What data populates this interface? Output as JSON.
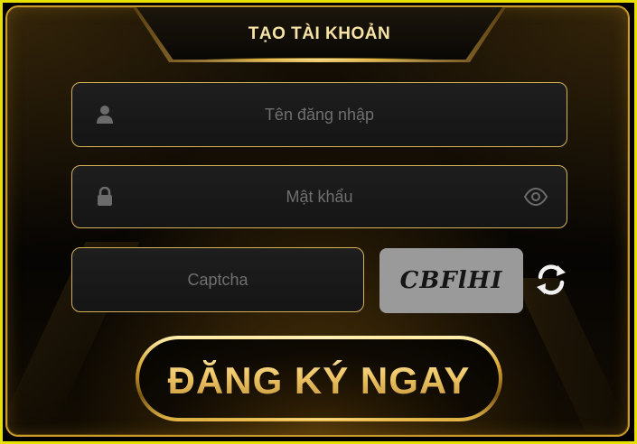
{
  "dialog": {
    "title": "TẠO TÀI KHOẢN"
  },
  "form": {
    "username": {
      "placeholder": "Tên đăng nhập",
      "value": "",
      "icon": "user-icon"
    },
    "password": {
      "placeholder": "Mật khẩu",
      "value": "",
      "icon": "lock-icon",
      "toggle_icon": "eye-icon"
    },
    "captcha": {
      "placeholder": "Captcha",
      "value": "",
      "code": "CBFlHI",
      "refresh_icon": "refresh-icon"
    },
    "submit_label": "ĐĂNG KÝ NGAY"
  },
  "colors": {
    "accent_gold": "#d6b256",
    "frame_yellow": "#e8e000",
    "field_bg": "#1a1a1a",
    "captcha_bg": "#9a9a9a"
  }
}
